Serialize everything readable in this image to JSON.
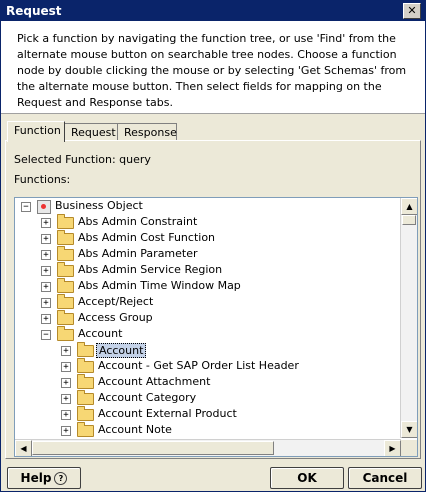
{
  "window": {
    "title": "Request",
    "close_glyph": "✕"
  },
  "description": "Pick a function by navigating the function tree, or use 'Find' from the alternate mouse button on searchable tree nodes. Choose a function node by double clicking the mouse or by selecting 'Get Schemas' from the alternate mouse button. Then select fields for mapping on the Request and Response tabs.",
  "tabs": [
    {
      "label": "Function",
      "active": true
    },
    {
      "label": "Request",
      "active": false
    },
    {
      "label": "Response",
      "active": false
    }
  ],
  "selected_function_label": "Selected Function: query",
  "functions_label": "Functions:",
  "tree": {
    "root": "Business Object",
    "items": [
      "Abs Admin Constraint",
      "Abs Admin Cost Function",
      "Abs Admin Parameter",
      "Abs Admin Service Region",
      "Abs Admin Time Window Map",
      "Accept/Reject",
      "Access Group",
      "Account"
    ],
    "children": [
      "Account",
      "Account - Get SAP Order List Header",
      "Account Attachment",
      "Account Category",
      "Account External Product",
      "Account Note"
    ]
  },
  "buttons": {
    "help": "Help",
    "help_icon": "?",
    "ok": "OK",
    "cancel": "Cancel"
  }
}
